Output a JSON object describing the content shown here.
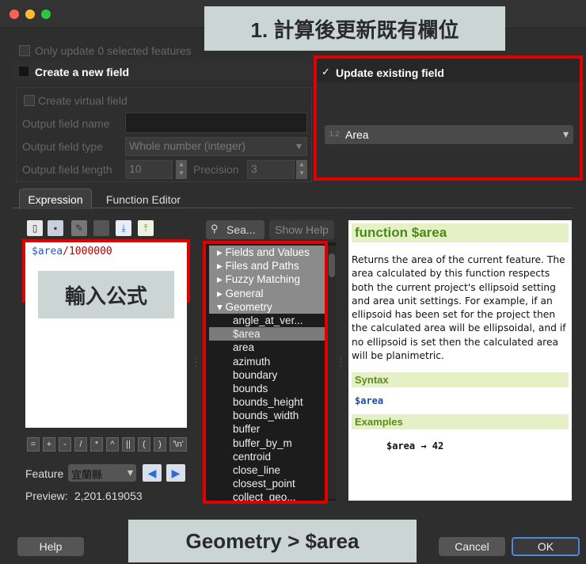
{
  "banners": {
    "top": "1. 計算後更新既有欄位",
    "formula": "輸入公式",
    "bottom": "Geometry > $area"
  },
  "options": {
    "only_update": "Only update 0 selected features",
    "create_new": "Create a new field",
    "update_existing": "Update existing field",
    "virtual": "Create virtual field"
  },
  "output": {
    "name_label": "Output field name",
    "type_label": "Output field type",
    "type_value": "Whole number (integer)",
    "length_label": "Output field length",
    "length_value": "10",
    "precision_label": "Precision",
    "precision_value": "3"
  },
  "existing_field": {
    "prefix": "1.2",
    "value": "Area"
  },
  "tabs": {
    "expression": "Expression",
    "function_editor": "Function Editor"
  },
  "expression": {
    "var": "$area",
    "op": "/",
    "num": "1000000"
  },
  "search": {
    "placeholder": "Sea...",
    "show_help": "Show Help"
  },
  "tree": {
    "groups": [
      "Fields and Values",
      "Files and Paths",
      "Fuzzy Matching",
      "General",
      "Geometry"
    ],
    "items": [
      "angle_at_ver...",
      "$area",
      "area",
      "azimuth",
      "boundary",
      "bounds",
      "bounds_height",
      "bounds_width",
      "buffer",
      "buffer_by_m",
      "centroid",
      "close_line",
      "closest_point",
      "collect_geo..."
    ]
  },
  "operators": [
    "=",
    "+",
    "-",
    "/",
    "*",
    "^",
    "||",
    "(",
    ")",
    "'\\n'"
  ],
  "feature": {
    "label": "Feature",
    "value": "宜蘭縣"
  },
  "preview": {
    "label": "Preview:",
    "value": "2,201.619053"
  },
  "help": {
    "title": "function $area",
    "description": "Returns the area of the current feature. The area calculated by this function respects both the current project's ellipsoid setting and area unit settings. For example, if an ellipsoid has been set for the project then the calculated area will be ellipsoidal, and if no ellipsoid is set then the calculated area will be planimetric.",
    "syntax_h": "Syntax",
    "syntax": "$area",
    "examples_h": "Examples",
    "example": "$area → 42"
  },
  "buttons": {
    "help": "Help",
    "cancel": "Cancel",
    "ok": "OK"
  },
  "colors": {
    "red_box": "#e10000",
    "banner": "#cbd5d4",
    "close": "#fe5f57",
    "min": "#febc2e",
    "max": "#28c840"
  }
}
